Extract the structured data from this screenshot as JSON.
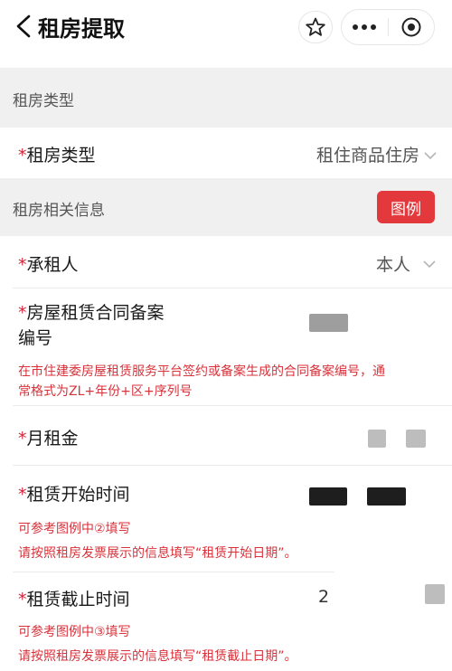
{
  "nav": {
    "title": "租房提取",
    "icons": [
      "chevron-left-icon",
      "star-icon",
      "more-icon",
      "target-icon"
    ]
  },
  "section1": {
    "title": "租房类型"
  },
  "rental_type": {
    "label": "租房类型",
    "value": "租住商品住房"
  },
  "section2": {
    "title": "租房相关信息",
    "legend_button": "图例"
  },
  "lessee": {
    "label": "承租人",
    "value": "本人"
  },
  "contract_no": {
    "label_line1": "房屋租赁合同备案",
    "label_line2": "编号",
    "hint_line1": "在市住建委房屋租赁服务平台签约或备案生成的合同备案编号，通",
    "hint_line2": "常格式为ZL+年份+区+序列号"
  },
  "monthly_rent": {
    "label": "月租金"
  },
  "start_time": {
    "label": "租赁开始时间",
    "hint_line1": "可参考图例中②填写",
    "hint_line2": "请按照租房发票展示的信息填写“租赁开始日期”。"
  },
  "end_time": {
    "label": "租赁截止时间",
    "value_partial": "2",
    "hint_line1": "可参考图例中③填写",
    "hint_line2": "请按照租房发票展示的信息填写“租赁截止日期”。"
  },
  "required_mark": "*",
  "colors": {
    "accent_red": "#e4393c",
    "hint_red": "#d8323b",
    "section_bg": "#f0f0f0"
  }
}
